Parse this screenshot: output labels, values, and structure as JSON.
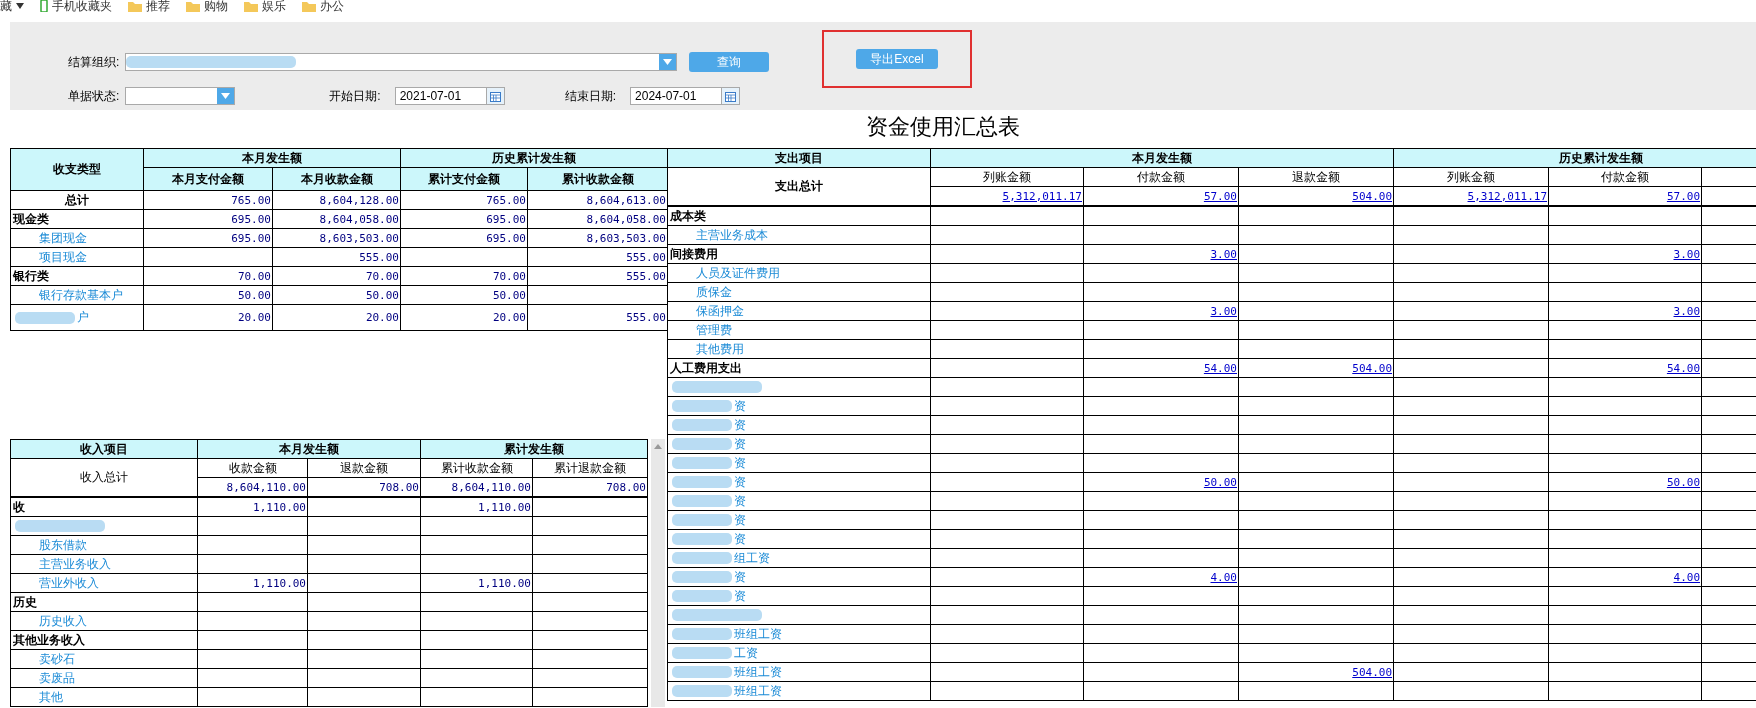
{
  "bookmarks": [
    {
      "kind": "menu",
      "label": "藏"
    },
    {
      "kind": "phone",
      "label": "手机收藏夹"
    },
    {
      "kind": "folder",
      "label": "推荐"
    },
    {
      "kind": "folder",
      "label": "购物"
    },
    {
      "kind": "folder",
      "label": "娱乐"
    },
    {
      "kind": "folder",
      "label": "办公"
    }
  ],
  "filters": {
    "org_label": "结算组织:",
    "status_label": "单据状态:",
    "start_label": "开始日期:",
    "start_value": "2021-07-01",
    "end_label": "结束日期:",
    "end_value": "2024-07-01",
    "query_button": "查询",
    "export_button": "导出Excel"
  },
  "title": "资金使用汇总表",
  "type_table": {
    "corner": "收支类型",
    "groups": [
      {
        "label": "本月发生额",
        "columns": [
          "本月支付金额",
          "本月收款金额"
        ]
      },
      {
        "label": "历史累计发生额",
        "columns": [
          "累计支付金额",
          "累计收款金额"
        ]
      }
    ],
    "rows": [
      {
        "kind": "total",
        "label": "总计",
        "amounts": {
          "col_1": "765.00",
          "col_2": "8,604,128.00",
          "col_3": "765.00",
          "col_4": "8,604,613.00"
        }
      },
      {
        "kind": "group",
        "label": "现金类",
        "amounts": {
          "col_1": "695.00",
          "col_2": "8,604,058.00",
          "col_3": "695.00",
          "col_4": "8,604,058.00"
        }
      },
      {
        "kind": "item",
        "label": "集团现金",
        "amounts": {
          "col_1": "695.00",
          "col_2": "8,603,503.00",
          "col_3": "695.00",
          "col_4": "8,603,503.00"
        }
      },
      {
        "kind": "item",
        "label": "项目现金",
        "amounts": {
          "col_2": "555.00",
          "col_4": "555.00"
        }
      },
      {
        "kind": "group",
        "label": "银行类",
        "amounts": {
          "col_1": "70.00",
          "col_2": "70.00",
          "col_3": "70.00",
          "col_4": "555.00"
        }
      },
      {
        "kind": "item",
        "label": "银行存款基本户",
        "amounts": {
          "col_1": "50.00",
          "col_2": "50.00",
          "col_3": "50.00"
        }
      },
      {
        "kind": "partial",
        "label": "户",
        "amounts": {
          "col_1": "20.00",
          "col_2": "20.00",
          "col_3": "20.00",
          "col_4": "555.00"
        }
      }
    ]
  },
  "income_table": {
    "corner": "收入项目",
    "total_label": "收入总计",
    "groups": [
      {
        "label": "本月发生额",
        "columns": [
          "收款金额",
          "退款金额"
        ]
      },
      {
        "label": "累计发生额",
        "columns": [
          "累计收款金额",
          "累计退款金额"
        ]
      }
    ],
    "totals": [
      "8,604,110.00",
      "708.00",
      "8,604,110.00",
      "708.00"
    ],
    "rows": [
      {
        "kind": "group",
        "label": "收",
        "amounts": {
          "col_1": "1,110.00",
          "col_3": "1,110.00"
        }
      },
      {
        "kind": "partial"
      },
      {
        "kind": "item",
        "label": "股东借款"
      },
      {
        "kind": "item",
        "label": "主营业务收入"
      },
      {
        "kind": "item",
        "label": "营业外收入",
        "amounts": {
          "col_1": "1,110.00",
          "col_3": "1,110.00"
        }
      },
      {
        "kind": "group",
        "label": "历史"
      },
      {
        "kind": "item",
        "label": "历史收入"
      },
      {
        "kind": "group",
        "label": "其他业务收入"
      },
      {
        "kind": "item",
        "label": "卖砂石"
      },
      {
        "kind": "item",
        "label": "卖废品"
      },
      {
        "kind": "item",
        "label": "其他"
      }
    ]
  },
  "expense_table": {
    "corner": "支出项目",
    "total_label": "支出总计",
    "groups": [
      {
        "label": "本月发生额",
        "columns": [
          "列账金额",
          "付款金额",
          "退款金额"
        ]
      },
      {
        "label": "历史累计发生额",
        "columns": [
          "列账金额",
          "付款金额"
        ]
      }
    ],
    "totals": [
      "5,312,011.17",
      "57.00",
      "504.00",
      "5,312,011.17",
      "57.00"
    ],
    "rows": [
      {
        "kind": "group",
        "label": "成本类"
      },
      {
        "kind": "item",
        "label": "主营业务成本"
      },
      {
        "kind": "group",
        "label": "间接费用",
        "amounts": {
          "col_2": "3.00",
          "col_5": "3.00"
        }
      },
      {
        "kind": "item",
        "label": "人员及证件费用"
      },
      {
        "kind": "item",
        "label": "质保金"
      },
      {
        "kind": "item",
        "label": "保函押金",
        "amounts": {
          "col_2": "3.00",
          "col_5": "3.00"
        }
      },
      {
        "kind": "item",
        "label": "管理费"
      },
      {
        "kind": "item",
        "label": "其他费用"
      },
      {
        "kind": "group",
        "label": "人工费用支出",
        "amounts": {
          "col_2": "54.00",
          "col_3": "504.00",
          "col_5": "54.00"
        }
      },
      {
        "kind": "partial"
      },
      {
        "kind": "partial",
        "label": "资"
      },
      {
        "kind": "partial",
        "label": "资"
      },
      {
        "kind": "partial",
        "label": "资"
      },
      {
        "kind": "partial",
        "label": "资"
      },
      {
        "kind": "partial",
        "label": "资",
        "amounts": {
          "col_2": "50.00",
          "col_5": "50.00"
        }
      },
      {
        "kind": "partial",
        "label": "资"
      },
      {
        "kind": "partial",
        "label": "资"
      },
      {
        "kind": "partial",
        "label": "资"
      },
      {
        "kind": "partial",
        "label": "组工资"
      },
      {
        "kind": "partial",
        "label": "资",
        "amounts": {
          "col_2": "4.00",
          "col_5": "4.00"
        }
      },
      {
        "kind": "partial",
        "label": "资"
      },
      {
        "kind": "partial"
      },
      {
        "kind": "partial",
        "label": "班组工资"
      },
      {
        "kind": "partial",
        "label": "工资"
      },
      {
        "kind": "partial",
        "label": "班组工资",
        "amounts": {
          "col_3": "504.00"
        }
      },
      {
        "kind": "partial",
        "label": "班组工资"
      }
    ]
  }
}
